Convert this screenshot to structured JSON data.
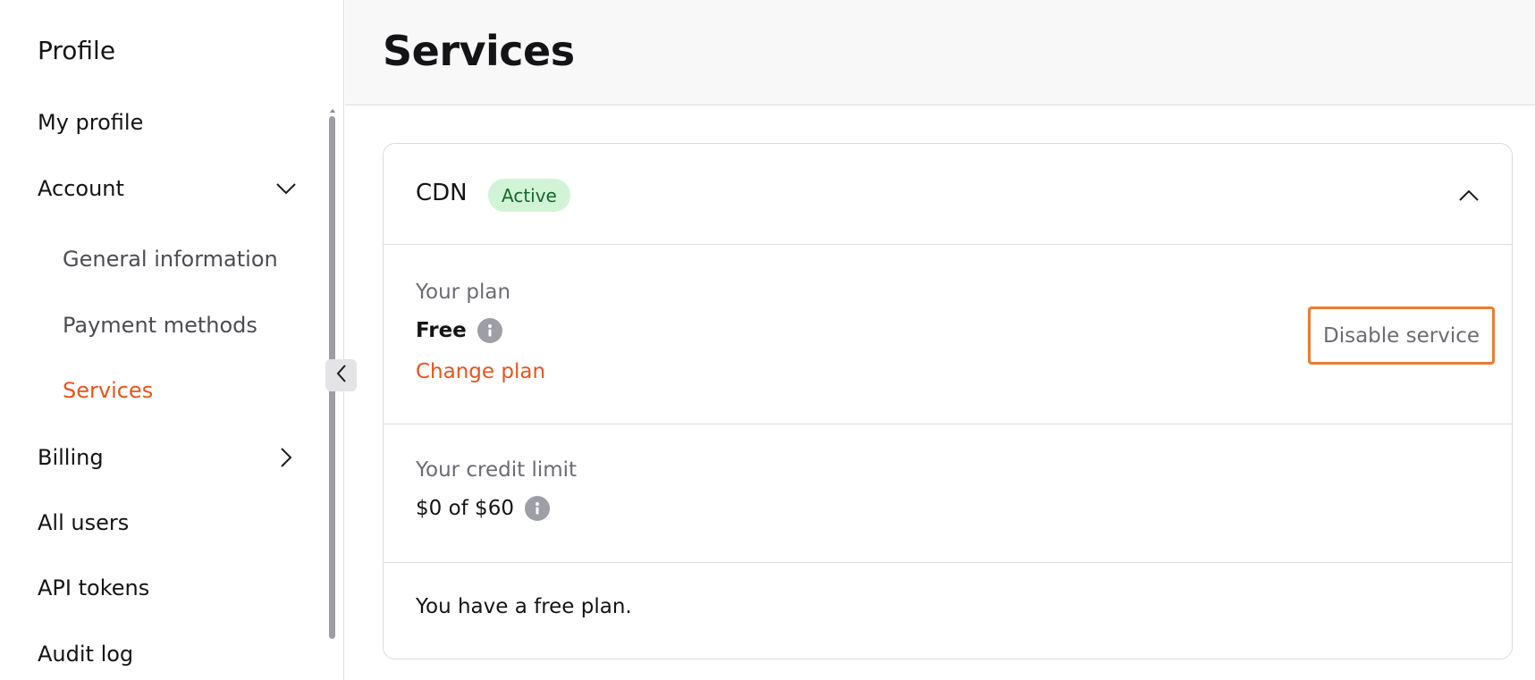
{
  "sidebar": {
    "title": "Profile",
    "items": [
      {
        "label": "My profile"
      },
      {
        "label": "Account",
        "chevron": "chevron-down"
      },
      {
        "label": "General information"
      },
      {
        "label": "Payment methods"
      },
      {
        "label": "Services",
        "active": true
      },
      {
        "label": "Billing",
        "chevron": "chevron-right"
      },
      {
        "label": "All users"
      },
      {
        "label": "API tokens"
      },
      {
        "label": "Audit log"
      }
    ]
  },
  "header": {
    "title": "Services"
  },
  "service_card": {
    "name": "CDN",
    "status": "Active",
    "plan": {
      "label": "Your plan",
      "value": "Free",
      "change_label": "Change plan",
      "disable_label": "Disable service"
    },
    "credit": {
      "label": "Your credit limit",
      "value": "$0 of $60"
    },
    "note": "You have a free plan."
  },
  "colors": {
    "accent": "#e9531c",
    "badge_bg": "#d2f4d6",
    "badge_text": "#14672a",
    "highlight_border": "#ee7b30"
  }
}
